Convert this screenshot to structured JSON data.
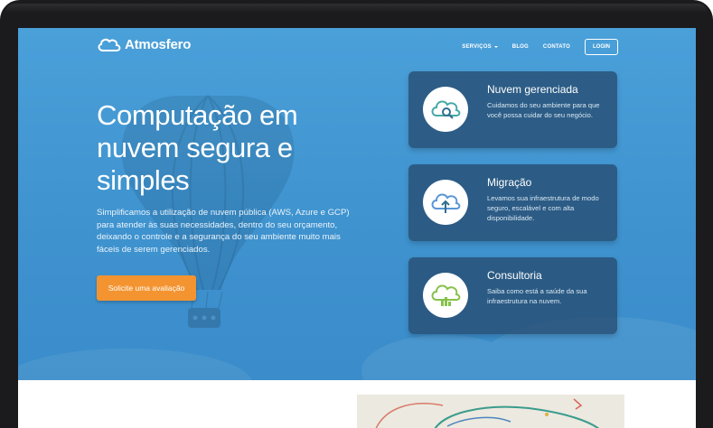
{
  "brand": {
    "name": "Atmosfero",
    "logo_icon": "cloud-icon"
  },
  "nav": {
    "items": [
      {
        "label": "SERVIÇOS",
        "has_dropdown": true
      },
      {
        "label": "BLOG",
        "has_dropdown": false
      },
      {
        "label": "CONTATO",
        "has_dropdown": false
      }
    ],
    "login_label": "LOGIN"
  },
  "hero": {
    "headline": "Computação em nuvem segura e simples",
    "subtext": "Simplificamos a utilização de nuvem pública (AWS, Azure e GCP) para atender às suas necessidades, dentro do seu orçamento, deixando o controle e a segurança do seu ambiente muito mais fáceis de serem gerenciados.",
    "cta_label": "Solicite uma avaliação"
  },
  "services": [
    {
      "title": "Nuvem gerenciada",
      "description": "Cuidamos do seu ambiente para que você possa cuidar do seu negócio.",
      "icon": "cloud-search-icon",
      "color": "#46aaa8"
    },
    {
      "title": "Migração",
      "description": "Levamos sua infraestrutura de modo seguro, escalável e com alta disponibilidade.",
      "icon": "cloud-upload-icon",
      "color": "#5a96d6"
    },
    {
      "title": "Consultoria",
      "description": "Saiba como está a saúde da sua infraestrutura na nuvem.",
      "icon": "cloud-chart-icon",
      "color": "#86c14a"
    }
  ],
  "colors": {
    "hero_bg": "#4399d3",
    "cta": "#f39431",
    "card_bg": "#2c5779"
  }
}
